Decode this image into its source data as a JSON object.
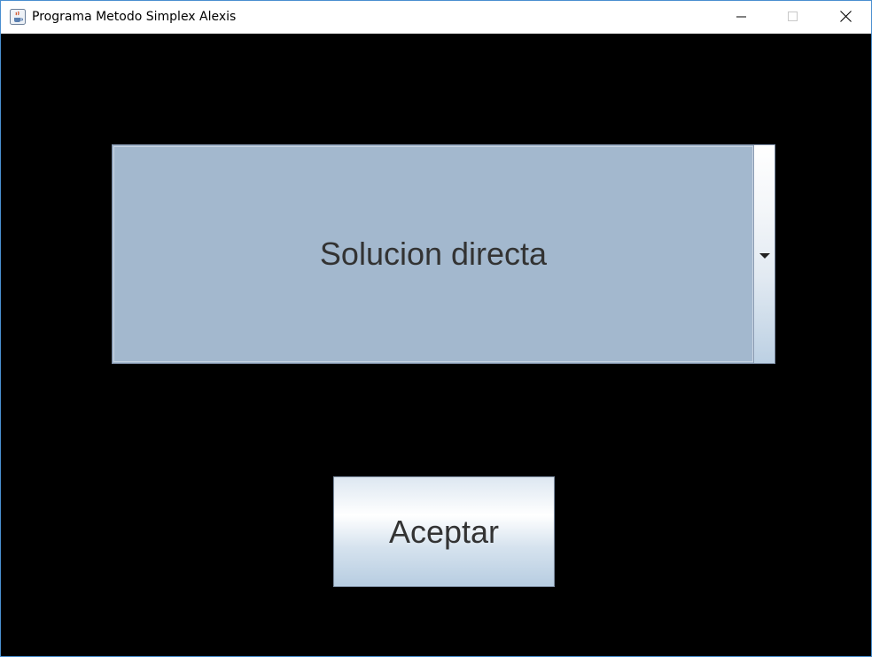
{
  "window": {
    "title": "Programa Metodo Simplex Alexis",
    "app_icon": "java-coffee-icon",
    "controls": {
      "minimize_icon": "minimize-icon",
      "maximize_icon": "maximize-icon",
      "close_icon": "close-icon"
    }
  },
  "main": {
    "combo": {
      "selected_value": "Solucion directa",
      "arrow_icon": "chevron-down-icon"
    },
    "accept_button": {
      "label": "Aceptar"
    }
  },
  "colors": {
    "background": "#000000",
    "combo_fill": "#a3b8ce",
    "text": "#333333",
    "window_border": "#4a8fd0"
  }
}
